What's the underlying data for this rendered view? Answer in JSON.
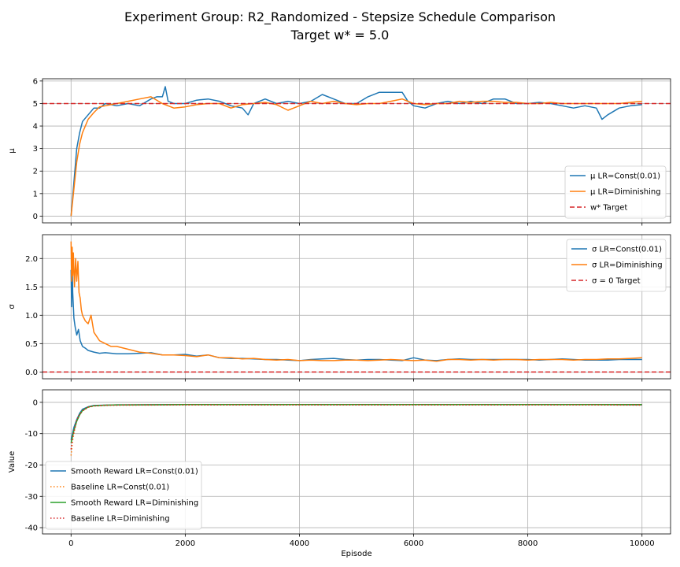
{
  "figure": {
    "title_line1": "Experiment Group: R2_Randomized - Stepsize Schedule Comparison",
    "title_line2": "Target w* = 5.0"
  },
  "chart_data": [
    {
      "type": "line",
      "ylabel": "μ",
      "xlabel": "",
      "xlim": [
        -500,
        10500
      ],
      "ylim": [
        -0.3,
        6.1
      ],
      "xticks": [
        0,
        2000,
        4000,
        6000,
        8000,
        10000
      ],
      "yticks": [
        0,
        1,
        2,
        3,
        4,
        5,
        6
      ],
      "grid": true,
      "legend_position": "lower-right",
      "series": [
        {
          "name": "μ LR=Const(0.01)",
          "color": "#1f77b4",
          "style": "solid",
          "x": [
            0,
            50,
            100,
            150,
            200,
            300,
            400,
            500,
            600,
            800,
            1000,
            1200,
            1400,
            1500,
            1600,
            1650,
            1700,
            1800,
            2000,
            2200,
            2400,
            2600,
            2800,
            3000,
            3100,
            3200,
            3400,
            3600,
            3800,
            4000,
            4200,
            4400,
            4600,
            4800,
            5000,
            5200,
            5400,
            5600,
            5800,
            5900,
            6000,
            6200,
            6400,
            6600,
            6800,
            7000,
            7200,
            7400,
            7600,
            7800,
            8000,
            8200,
            8400,
            8600,
            8800,
            9000,
            9200,
            9300,
            9400,
            9600,
            9800,
            10000
          ],
          "y": [
            0.0,
            1.5,
            3.0,
            3.7,
            4.2,
            4.5,
            4.8,
            4.8,
            5.0,
            4.9,
            5.0,
            4.9,
            5.2,
            5.3,
            5.3,
            5.75,
            5.1,
            5.0,
            5.0,
            5.15,
            5.2,
            5.1,
            4.9,
            4.8,
            4.5,
            5.0,
            5.2,
            5.0,
            5.1,
            5.0,
            5.1,
            5.4,
            5.2,
            5.0,
            5.0,
            5.3,
            5.5,
            5.5,
            5.5,
            5.1,
            4.9,
            4.8,
            5.0,
            5.1,
            5.0,
            5.1,
            5.0,
            5.2,
            5.2,
            5.0,
            5.0,
            5.05,
            5.0,
            4.9,
            4.8,
            4.9,
            4.8,
            4.3,
            4.5,
            4.8,
            4.9,
            4.95
          ]
        },
        {
          "name": "μ LR=Diminishing",
          "color": "#ff7f0e",
          "style": "solid",
          "x": [
            0,
            50,
            100,
            150,
            200,
            300,
            400,
            500,
            600,
            800,
            1000,
            1200,
            1400,
            1600,
            1800,
            2000,
            2200,
            2400,
            2600,
            2800,
            3000,
            3200,
            3400,
            3600,
            3800,
            4000,
            4200,
            4400,
            4600,
            4800,
            5000,
            5200,
            5400,
            5600,
            5800,
            6000,
            6200,
            6400,
            6600,
            6800,
            7000,
            7200,
            7400,
            7600,
            7800,
            8000,
            8200,
            8400,
            8600,
            8800,
            9000,
            9200,
            9400,
            9600,
            9800,
            10000
          ],
          "y": [
            0.0,
            1.2,
            2.4,
            3.2,
            3.7,
            4.3,
            4.6,
            4.85,
            4.9,
            5.0,
            5.1,
            5.2,
            5.3,
            5.0,
            4.8,
            4.85,
            4.95,
            5.0,
            5.0,
            4.8,
            4.95,
            5.0,
            5.05,
            4.95,
            4.7,
            4.9,
            5.1,
            5.0,
            5.1,
            5.0,
            4.95,
            5.0,
            5.0,
            5.1,
            5.2,
            5.0,
            4.95,
            5.0,
            5.0,
            5.1,
            5.05,
            5.1,
            5.1,
            5.05,
            5.05,
            5.0,
            5.0,
            5.05,
            5.0,
            5.0,
            5.0,
            5.0,
            5.0,
            5.0,
            5.05,
            5.1
          ]
        },
        {
          "name": "w* Target",
          "color": "#d62728",
          "style": "dashed",
          "hline": 5.0
        }
      ]
    },
    {
      "type": "line",
      "ylabel": "σ",
      "xlabel": "",
      "xlim": [
        -500,
        10500
      ],
      "ylim": [
        -0.12,
        2.42
      ],
      "xticks": [
        0,
        2000,
        4000,
        6000,
        8000,
        10000
      ],
      "yticks": [
        0.0,
        0.5,
        1.0,
        1.5,
        2.0
      ],
      "ytick_labels": [
        "0.0",
        "0.5",
        "1.0",
        "1.5",
        "2.0"
      ],
      "grid": true,
      "legend_position": "upper-right",
      "series": [
        {
          "name": "σ LR=Const(0.01)",
          "color": "#1f77b4",
          "style": "solid",
          "x": [
            0,
            10,
            20,
            30,
            50,
            70,
            100,
            130,
            160,
            200,
            250,
            300,
            400,
            500,
            600,
            800,
            1000,
            1200,
            1400,
            1600,
            1800,
            2000,
            2200,
            2400,
            2600,
            2800,
            3000,
            3200,
            3400,
            3600,
            3800,
            4000,
            4200,
            4400,
            4600,
            4800,
            5000,
            5200,
            5400,
            5600,
            5800,
            6000,
            6200,
            6400,
            6600,
            6800,
            7000,
            7200,
            7400,
            7600,
            7800,
            8000,
            8200,
            8400,
            8600,
            8800,
            9000,
            9200,
            9400,
            9600,
            9800,
            10000
          ],
          "y": [
            1.8,
            1.15,
            1.9,
            1.4,
            0.95,
            0.8,
            0.65,
            0.75,
            0.55,
            0.45,
            0.42,
            0.38,
            0.35,
            0.33,
            0.34,
            0.32,
            0.32,
            0.33,
            0.34,
            0.3,
            0.3,
            0.31,
            0.28,
            0.3,
            0.25,
            0.24,
            0.24,
            0.23,
            0.22,
            0.22,
            0.21,
            0.2,
            0.22,
            0.23,
            0.24,
            0.22,
            0.21,
            0.22,
            0.22,
            0.21,
            0.2,
            0.25,
            0.21,
            0.2,
            0.22,
            0.23,
            0.22,
            0.22,
            0.22,
            0.22,
            0.22,
            0.22,
            0.21,
            0.22,
            0.23,
            0.22,
            0.21,
            0.21,
            0.21,
            0.22,
            0.22,
            0.22
          ]
        },
        {
          "name": "σ LR=Diminishing",
          "color": "#ff7f0e",
          "style": "solid",
          "x": [
            0,
            10,
            20,
            30,
            40,
            60,
            80,
            100,
            120,
            140,
            160,
            180,
            200,
            250,
            300,
            350,
            400,
            500,
            600,
            700,
            800,
            1000,
            1200,
            1400,
            1600,
            1800,
            2000,
            2200,
            2400,
            2600,
            2800,
            3000,
            3200,
            3400,
            3600,
            3800,
            4000,
            4200,
            4400,
            4600,
            4800,
            5000,
            5200,
            5400,
            5600,
            5800,
            6000,
            6200,
            6400,
            6600,
            6800,
            7000,
            7200,
            7400,
            7600,
            7800,
            8000,
            8200,
            8400,
            8600,
            8800,
            9000,
            9200,
            9400,
            9600,
            9800,
            10000
          ],
          "y": [
            2.3,
            1.6,
            2.2,
            1.7,
            2.1,
            1.5,
            2.0,
            1.6,
            1.95,
            1.4,
            1.3,
            1.1,
            1.0,
            0.9,
            0.85,
            1.0,
            0.7,
            0.55,
            0.5,
            0.45,
            0.45,
            0.4,
            0.35,
            0.33,
            0.3,
            0.3,
            0.29,
            0.27,
            0.3,
            0.25,
            0.25,
            0.23,
            0.24,
            0.22,
            0.21,
            0.22,
            0.2,
            0.21,
            0.2,
            0.2,
            0.21,
            0.21,
            0.2,
            0.21,
            0.22,
            0.21,
            0.2,
            0.21,
            0.19,
            0.22,
            0.22,
            0.21,
            0.22,
            0.21,
            0.22,
            0.22,
            0.21,
            0.22,
            0.22,
            0.22,
            0.21,
            0.22,
            0.22,
            0.23,
            0.23,
            0.24,
            0.25
          ]
        },
        {
          "name": "σ = 0 Target",
          "color": "#d62728",
          "style": "dashed",
          "hline": 0.0
        }
      ]
    },
    {
      "type": "line",
      "ylabel": "Value",
      "xlabel": "Episode",
      "xlim": [
        -500,
        10500
      ],
      "ylim": [
        -42,
        4
      ],
      "xticks": [
        0,
        2000,
        4000,
        6000,
        8000,
        10000
      ],
      "yticks": [
        -40,
        -30,
        -20,
        -10,
        0
      ],
      "grid": true,
      "legend_position": "lower-left",
      "series": [
        {
          "name": "Smooth Reward LR=Const(0.01)",
          "color": "#1f77b4",
          "style": "solid",
          "x": [
            0,
            50,
            100,
            150,
            200,
            300,
            400,
            600,
            800,
            1000,
            2000,
            3000,
            4000,
            5000,
            6000,
            7000,
            8000,
            9000,
            10000
          ],
          "y": [
            -12,
            -8,
            -5.5,
            -3.5,
            -2.2,
            -1.4,
            -1.0,
            -0.9,
            -0.8,
            -0.8,
            -0.7,
            -0.7,
            -0.7,
            -0.7,
            -0.7,
            -0.7,
            -0.7,
            -0.7,
            -0.8
          ]
        },
        {
          "name": "Baseline LR=Const(0.01)",
          "color": "#ff7f0e",
          "style": "dotted",
          "x": [
            0,
            30,
            60,
            100,
            150,
            200,
            300,
            400,
            600,
            800,
            1000,
            2000,
            3000,
            4000,
            5000,
            6000,
            7000,
            8000,
            9000,
            10000
          ],
          "y": [
            -17,
            -12,
            -9,
            -6,
            -4,
            -2.8,
            -1.6,
            -1.2,
            -1.0,
            -0.9,
            -0.9,
            -0.8,
            -0.8,
            -0.8,
            -0.8,
            -0.8,
            -0.8,
            -0.8,
            -0.8,
            -0.9
          ]
        },
        {
          "name": "Smooth Reward LR=Diminishing",
          "color": "#2ca02c",
          "style": "solid",
          "x": [
            0,
            50,
            100,
            150,
            200,
            300,
            400,
            600,
            800,
            1000,
            2000,
            3000,
            4000,
            5000,
            6000,
            7000,
            8000,
            9000,
            10000
          ],
          "y": [
            -13,
            -9,
            -6,
            -4,
            -2.6,
            -1.5,
            -1.1,
            -0.9,
            -0.8,
            -0.8,
            -0.7,
            -0.7,
            -0.7,
            -0.7,
            -0.7,
            -0.7,
            -0.7,
            -0.7,
            -0.7
          ]
        },
        {
          "name": "Baseline LR=Diminishing",
          "color": "#d62728",
          "style": "dotted",
          "x": [
            0,
            30,
            60,
            100,
            150,
            200,
            300,
            400,
            600,
            800,
            1000,
            2000,
            3000,
            4000,
            5000,
            6000,
            7000,
            8000,
            9000,
            10000
          ],
          "y": [
            -15,
            -11,
            -8.5,
            -5.5,
            -3.8,
            -2.6,
            -1.5,
            -1.1,
            -0.9,
            -0.9,
            -0.8,
            -0.8,
            -0.8,
            -0.8,
            -0.8,
            -0.8,
            -0.8,
            -0.8,
            -0.8,
            -0.8
          ]
        }
      ]
    }
  ]
}
